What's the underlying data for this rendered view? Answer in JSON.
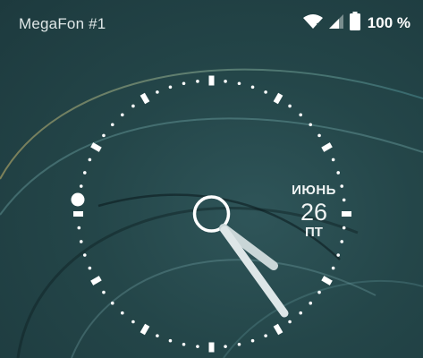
{
  "status_bar": {
    "carrier": "MegaFon #1",
    "battery_percent": "100 %",
    "icons": [
      "wifi-icon",
      "signal-icon",
      "battery-icon"
    ]
  },
  "clock": {
    "month": "ИЮНЬ",
    "day": "26",
    "weekday": "ПТ",
    "accent": "#ffffff"
  },
  "colors": {
    "background": "#244649",
    "text": "#ffffff"
  }
}
